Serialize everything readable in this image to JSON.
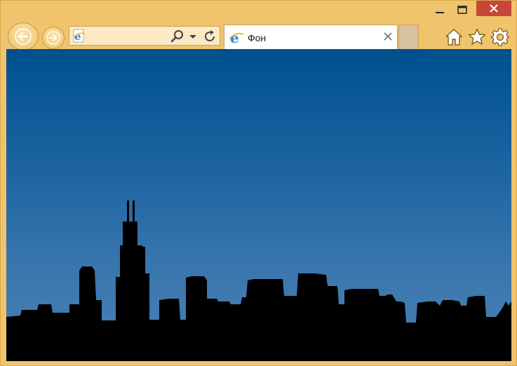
{
  "window": {
    "controls": [
      "minimize",
      "maximize",
      "close"
    ]
  },
  "address_bar": {
    "value": "",
    "page_icon": "ie-logo-icon"
  },
  "tab": {
    "title": "Фон",
    "icon": "ie-logo-icon"
  },
  "toolbar": {
    "icons": [
      "home-icon",
      "favorites-star-icon",
      "settings-gear-icon"
    ]
  },
  "colors": {
    "frame": "#f0c46c",
    "sky_top": "#00508e",
    "sky_bottom": "#4880b2",
    "close_button": "#c7463a",
    "skyline": "#000000"
  }
}
